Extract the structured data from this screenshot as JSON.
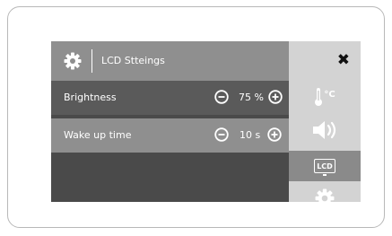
{
  "header": {
    "title": "LCD Stteings",
    "settings_icon": "gear-icon"
  },
  "rows": [
    {
      "label": "Brightness",
      "value": "75 %",
      "decrease_icon": "minus-circle-icon",
      "increase_icon": "plus-circle-icon"
    },
    {
      "label": "Wake up time",
      "value": "10 s",
      "decrease_icon": "minus-circle-icon",
      "increase_icon": "plus-circle-icon"
    }
  ],
  "sidebar": {
    "close_glyph": "✖",
    "temperature_unit": "°C",
    "lcd_label": "LCD",
    "items": [
      "close-icon",
      "thermometer-icon",
      "speaker-icon",
      "lcd-icon",
      "gear-icon"
    ]
  },
  "colors": {
    "header_bg": "#8f8f8f",
    "row_dark": "#5a5a5a",
    "row_light": "#8f8f8f",
    "sidebar_bg": "#d3d3d3",
    "sidebar_active": "#8a8a8a"
  }
}
